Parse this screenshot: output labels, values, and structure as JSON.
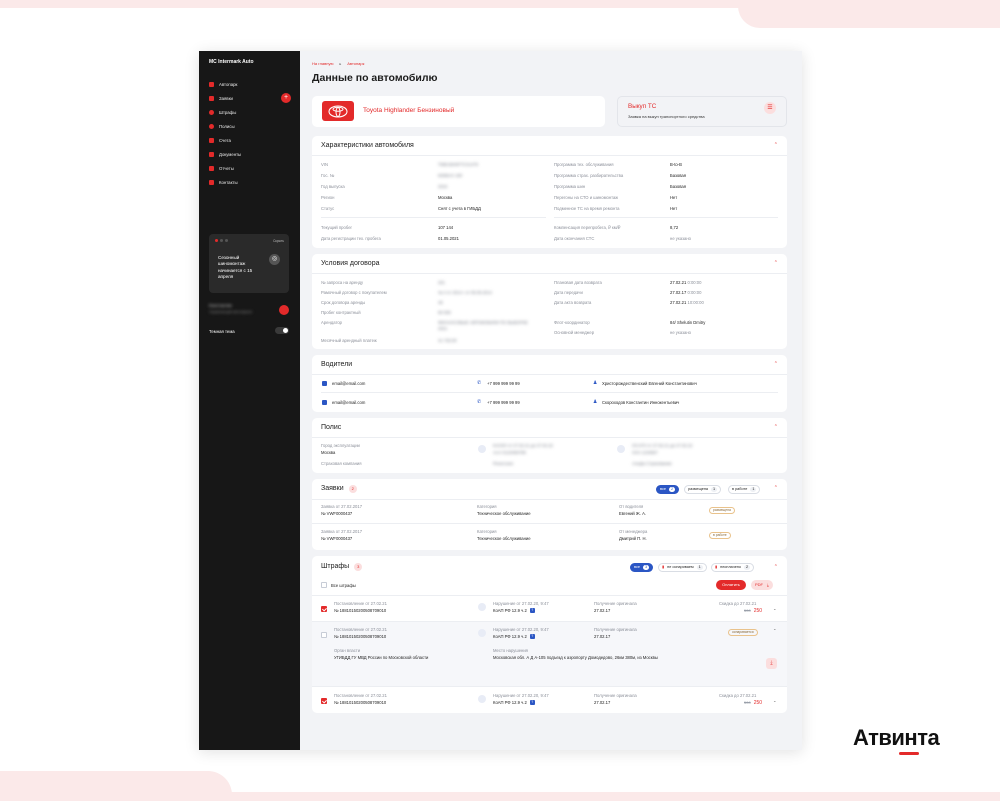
{
  "sidebar": {
    "brand": "MC Intermark Auto",
    "items": [
      {
        "label": "Автопарк",
        "icon": "car-list-icon"
      },
      {
        "label": "Заявки",
        "icon": "requests-icon"
      },
      {
        "label": "Штрафы",
        "icon": "fines-icon"
      },
      {
        "label": "Полисы",
        "icon": "shield-icon"
      },
      {
        "label": "Счета",
        "icon": "invoice-icon"
      },
      {
        "label": "Документы",
        "icon": "documents-icon"
      },
      {
        "label": "Отчеты",
        "icon": "reports-icon"
      },
      {
        "label": "Контакты",
        "icon": "contacts-icon"
      }
    ],
    "notification": {
      "hide_label": "Скрыть",
      "text": "Сезонный шиномонтаж начинается с 15 апреля"
    },
    "user": {
      "name": "Константин",
      "subtitle": "Управляющий автопарком"
    },
    "dark_theme_label": "Темная тема"
  },
  "breadcrumbs": [
    "На главную",
    "Автопарк"
  ],
  "page_title": "Данные по автомобилю",
  "car": {
    "name": "Toyota Highlander Бензиновый"
  },
  "buyout": {
    "title": "Выкуп ТС",
    "subtitle": "Заявка на выкуп транспортного средства"
  },
  "characteristics": {
    "title": "Характеристики автомобиля",
    "left": [
      {
        "label": "VIN",
        "value": "TMBAB4NP7CS1478"
      },
      {
        "label": "Гос. №",
        "value": "М368АХ 190"
      },
      {
        "label": "Год выпуска",
        "value": "2016"
      },
      {
        "label": "Регион",
        "value": "Москва"
      },
      {
        "label": "Статус",
        "value": "Снят с учета в ГИБДД"
      }
    ],
    "left2": [
      {
        "label": "Текущий пробег",
        "value": "107 144"
      },
      {
        "label": "Дата регистрации тех. пробега",
        "value": "01.05.2021"
      }
    ],
    "right": [
      {
        "label": "Программа тех. обслуживания",
        "value": "B-to-B"
      },
      {
        "label": "Программа страх. разбирательства",
        "value": "Базовая"
      },
      {
        "label": "Программа шин",
        "value": "Базовая"
      },
      {
        "label": "Перегоны на СТО и шиномонтаж",
        "value": "Нет"
      },
      {
        "label": "Подменное ТС на время ремонта",
        "value": "Нет"
      }
    ],
    "right2": [
      {
        "label": "Компенсация перепробега, ₽ км/₽",
        "value": "8,72"
      },
      {
        "label": "Дата окончания СТС",
        "value": "не указано"
      }
    ]
  },
  "contract": {
    "title": "Условия договора",
    "left": [
      {
        "label": "№ запроса на аренду",
        "value": "201"
      },
      {
        "label": "Рамочный договор с покупателем",
        "value": "№ 4 от 2014 г от 05.05.2014"
      },
      {
        "label": "Срок договора аренды",
        "value": "48"
      },
      {
        "label": "Пробег контрактный",
        "value": "80 000"
      },
      {
        "label": "Арендатор",
        "value": "ФИНАНСОВЫЕ АВТОМОБИЛИ ПО ВЫБОРКЕ 2021"
      },
      {
        "label": "Месячный арендный платеж",
        "value": "41 720,00"
      }
    ],
    "right": [
      {
        "label": "Плановая дата возврата",
        "value": "27.02.21",
        "extra": "0:00:00"
      },
      {
        "label": "Дата передачи",
        "value": "27.02.17",
        "extra": "0:00:00"
      },
      {
        "label": "Дата акта возврата",
        "value": "27.02.21",
        "extra": "10:00:00"
      },
      {
        "label": "Флот-координатор",
        "value": "84/ Shelutin Dmitry"
      },
      {
        "label": "Основной менеджер",
        "value": "не указано"
      }
    ]
  },
  "drivers": {
    "title": "Водители",
    "items": [
      {
        "email": "email@email.com",
        "phone": "+7 999 999 99 99",
        "name": "Христорождественский Евгений Константинович"
      },
      {
        "email": "email@email.com",
        "phone": "+7 999 999 99 99",
        "name": "Скороходов Константин Иннокентьевич"
      }
    ]
  },
  "policy": {
    "title": "Полис",
    "city_label": "Город эксплуатации",
    "city_value": "Москва",
    "insurer_label": "Страховая компания",
    "insurer_value": "Ренессанс",
    "col2_top": "КАСКО от 27.02.21 до 27.02.22",
    "col2_mid": "ААА 0123456789",
    "col3_top": "ОСАГО от 27.02.21 до 27.02.22",
    "col3_mid": "ХХХ 1234567",
    "col3_bot": "Альфа Страхование"
  },
  "requests": {
    "title": "Заявки",
    "count": "2",
    "filters": [
      {
        "label": "все",
        "count": "2",
        "active": true
      },
      {
        "label": "размещена",
        "count": "1",
        "active": false
      },
      {
        "label": "в работе",
        "count": "1",
        "active": false
      }
    ],
    "items": [
      {
        "date_label": "Заявка от 27.02.2017",
        "number": "№ VWF0000437",
        "cat_label": "Категория",
        "category": "Техническое обслуживание",
        "from_label": "От водителя",
        "from": "Евгений Ж. А.",
        "status": "размещена"
      },
      {
        "date_label": "Заявка от 27.02.2017",
        "number": "№ VWF0000437",
        "cat_label": "Категория",
        "category": "Техническое обслуживание",
        "from_label": "От менеджера",
        "from": "Дмитрий П. Н.",
        "status": "в работе"
      }
    ]
  },
  "fines": {
    "title": "Штрафы",
    "count": "3",
    "filters": [
      {
        "label": "все",
        "count": "3",
        "active": true
      },
      {
        "label": "не оспариваем",
        "count": "1",
        "active": false
      },
      {
        "label": "неоплачено",
        "count": "2",
        "active": false
      }
    ],
    "select_all": "Все штрафы",
    "pay_label": "Оплатить",
    "pdf_label": "PDF",
    "items": [
      {
        "decree_label": "Постановление от 27.02.21",
        "decree": "№ 18810150200508709010",
        "viol_label": "Нарушение от 27.02.20, 9:47",
        "koap": "КоАП РФ 12.9 ч.2",
        "recv_label": "Получение оригинала",
        "recv": "27.02.17",
        "disc_label": "Скидка до 27.02.21",
        "old_price": "500",
        "new_price": "250",
        "checked": true
      },
      {
        "decree_label": "Постановление от 27.02.21",
        "decree": "№ 18810150200508709010",
        "viol_label": "Нарушение от 27.02.20, 9:47",
        "koap": "КоАП РФ 12.9 ч.2",
        "recv_label": "Получение оригинала",
        "recv": "27.02.17",
        "status": "оспаривается",
        "checked": false,
        "organ_label": "Орган власти",
        "organ": "УГИБДД ГУ МВД России по Московской области",
        "place_label": "Место нарушения",
        "place": "Московская обл. А Д А-105 подъезд к аэропорту Домодедово, 26км 380м, из Москвы"
      },
      {
        "decree_label": "Постановление от 27.02.21",
        "decree": "№ 18810150200508709010",
        "viol_label": "Нарушение от 27.02.20, 9:47",
        "koap": "КоАП РФ 12.9 ч.2",
        "recv_label": "Получение оригинала",
        "recv": "27.02.17",
        "disc_label": "Скидка до 27.02.21",
        "old_price": "500",
        "new_price": "250",
        "checked": true
      }
    ]
  },
  "brand_logo": "Атвинта",
  "colors": {
    "accent": "#e32a2a",
    "blue": "#2b56c4",
    "sidebar": "#171717"
  }
}
